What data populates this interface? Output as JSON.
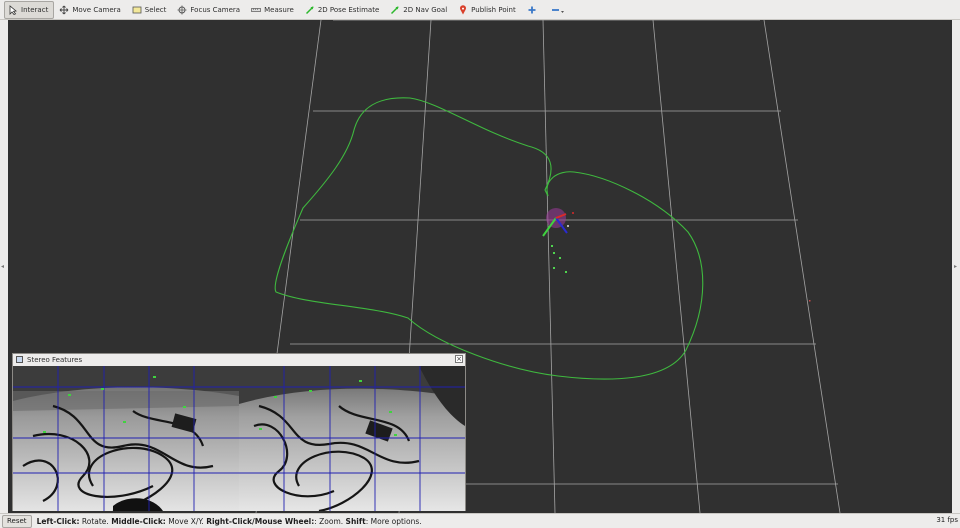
{
  "toolbar": {
    "tools": [
      {
        "label": "Interact",
        "icon": "cursor-icon",
        "active": true
      },
      {
        "label": "Move Camera",
        "icon": "move-camera-icon"
      },
      {
        "label": "Select",
        "icon": "select-icon"
      },
      {
        "label": "Focus Camera",
        "icon": "focus-camera-icon"
      },
      {
        "label": "Measure",
        "icon": "ruler-icon"
      },
      {
        "label": "2D Pose Estimate",
        "icon": "green-arrow-icon"
      },
      {
        "label": "2D Nav Goal",
        "icon": "green-arrow-icon"
      },
      {
        "label": "Publish Point",
        "icon": "map-pin-icon"
      }
    ]
  },
  "panel": {
    "title": "Stereo Features",
    "close": "×"
  },
  "status": {
    "reset": "Reset",
    "h1": "Left-Click:",
    "t1": " Rotate. ",
    "h2": "Middle-Click:",
    "t2": " Move X/Y. ",
    "h3": "Right-Click/Mouse Wheel:",
    "t3": ": Zoom. ",
    "h4": "Shift",
    "t4": ": More options.",
    "fps": "31 fps"
  },
  "colors": {
    "viewport_bg": "#303030",
    "grid": "#a0a0a0",
    "path": "#3fb83f",
    "feature_grid": "#2020b0"
  }
}
